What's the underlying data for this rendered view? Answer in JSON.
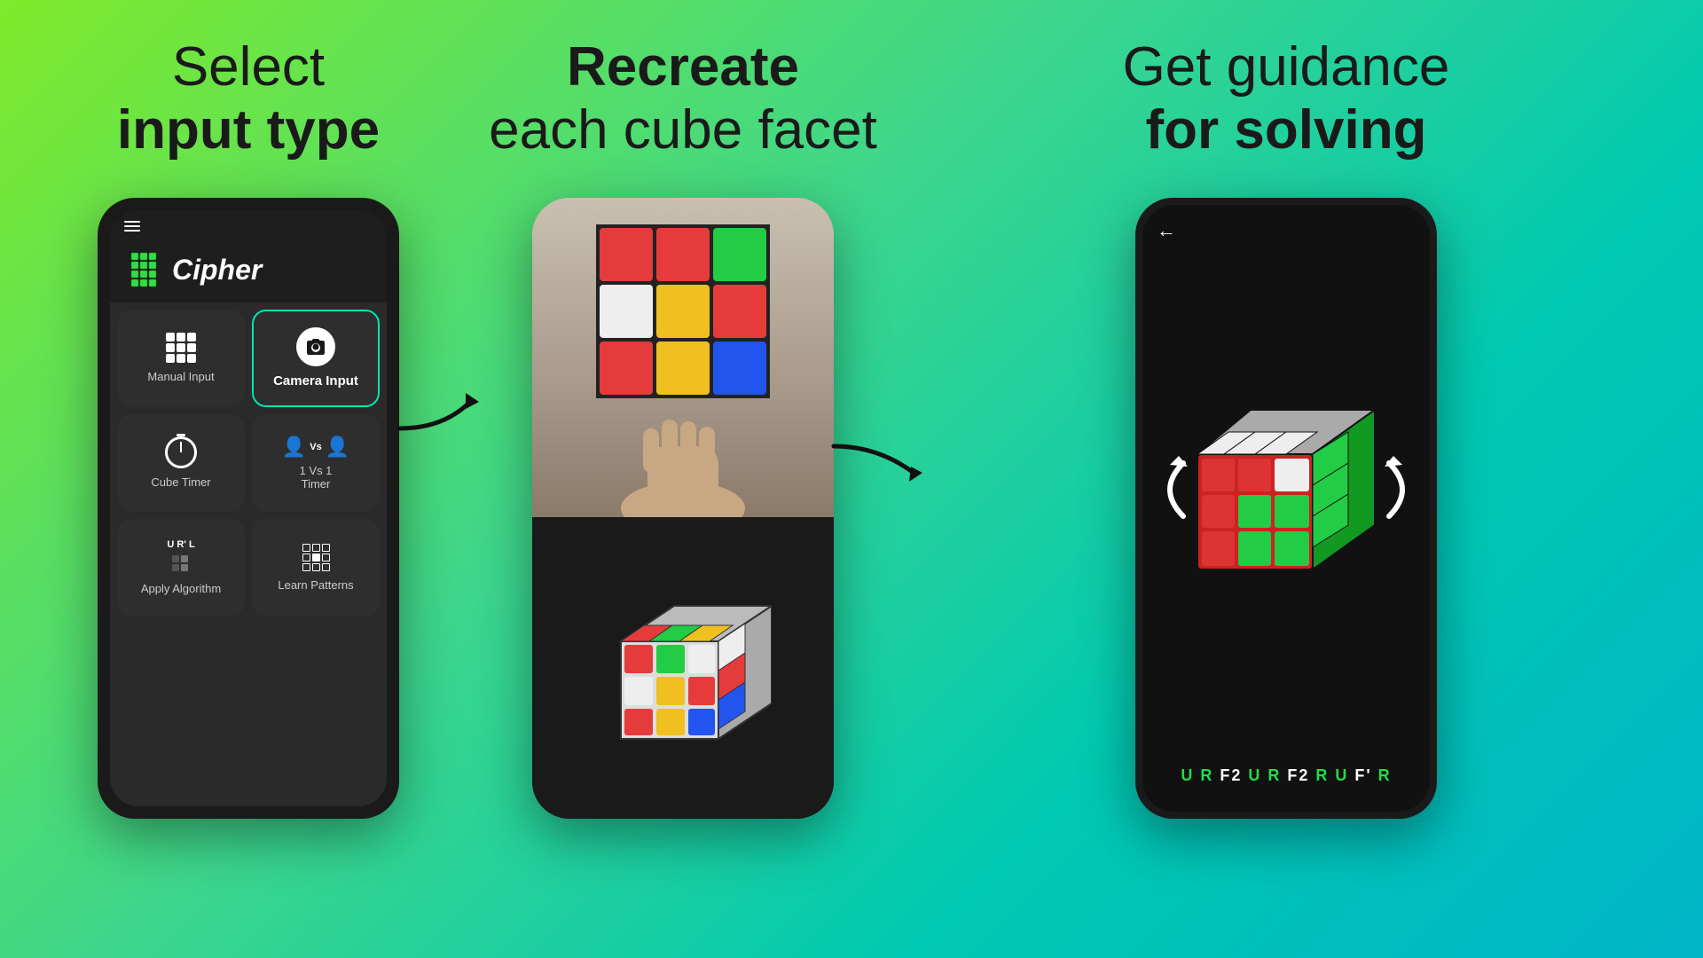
{
  "page": {
    "background": "linear-gradient(135deg, #7eea2a 0%, #3dd68c 40%, #00c9b1 70%, #00b5c8 100%)"
  },
  "sections": [
    {
      "id": "select",
      "heading_line1": "Select",
      "heading_line2_bold": "input type",
      "heading_line2_normal": ""
    },
    {
      "id": "recreate",
      "heading_line1": "Recreate",
      "heading_line2": "each cube facet",
      "bold_line1": true
    },
    {
      "id": "guidance",
      "heading_line1": "Get guidance",
      "heading_line2": "for solving",
      "bold_line2": true
    }
  ],
  "app": {
    "name": "Cipher",
    "menu_items": [
      {
        "id": "manual",
        "label": "Manual Input",
        "icon": "grid"
      },
      {
        "id": "camera",
        "label": "Camera Input",
        "icon": "camera",
        "highlighted": true
      },
      {
        "id": "timer",
        "label": "Cube Timer",
        "icon": "timer"
      },
      {
        "id": "vs",
        "label": "1 Vs 1\nTimer",
        "icon": "vs"
      },
      {
        "id": "algo",
        "label": "Apply Algorithm",
        "icon": "algorithm"
      },
      {
        "id": "patterns",
        "label": "Learn Patterns",
        "icon": "patterns"
      }
    ]
  },
  "rubik_face_colors": [
    "#e63b3b",
    "#e63b3b",
    "#22cc44",
    "#eeeeee",
    "#f0c020",
    "#e63b3b",
    "#e63b3b",
    "#f0c020",
    "#2255ee"
  ],
  "algorithm_sequence": {
    "display": "U R F2 U R F2 R U F' R",
    "green_letters": [
      "U",
      "R",
      "U",
      "R",
      "R",
      "U",
      "R"
    ],
    "white_letters": [
      "F2",
      "F2",
      "F'"
    ]
  },
  "back_button_label": "←"
}
